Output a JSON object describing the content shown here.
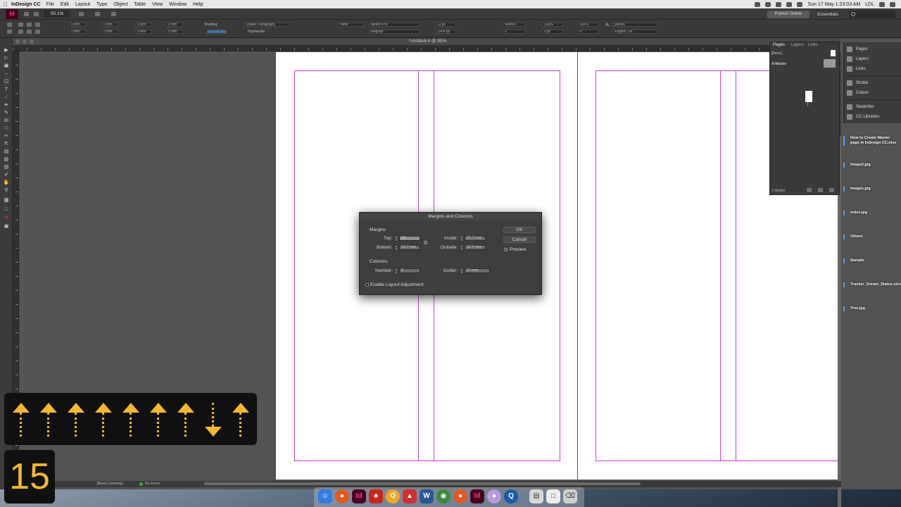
{
  "menubar": {
    "app_name": "InDesign CC",
    "items": [
      "File",
      "Edit",
      "Layout",
      "Type",
      "Object",
      "Table",
      "View",
      "Window",
      "Help"
    ],
    "clock": "Sun 17 May  1:23:03 AM",
    "user": "LDL"
  },
  "control": {
    "app_logo": "Id",
    "zoom": "95.1%",
    "publish_label": "Publish Online",
    "workspace": "Essentials",
    "shading_label": "Shading",
    "hyphenate_label": "Hyphenate",
    "paragraph_style": "[Basic Paragraph]",
    "font": "Minion Pro",
    "font_style": "Regular",
    "font_size": "12 pt",
    "leading": "(14.4 pt)",
    "kerning": "Metrics",
    "tracking": "0",
    "h_scale": "100%",
    "v_scale": "100%",
    "baseline": "0 pt",
    "skew": "0°",
    "char_style": "[None]",
    "language": "English: UK",
    "stroke_none": "None",
    "field_zero": "0 mm",
    "text_none": "[None]"
  },
  "document": {
    "title": "*Untitled-4 @ 95%"
  },
  "dialog": {
    "title": "Margins and Columns",
    "margins_label": "Margins",
    "top_label": "Top:",
    "top_value": "10",
    "bottom_label": "Bottom:",
    "bottom_value": "12.7 mm",
    "inside_label": "Inside:",
    "inside_value": "12.7 mm",
    "outside_label": "Outside:",
    "outside_value": "12.7 mm",
    "columns_label": "Columns",
    "number_label": "Number:",
    "number_value": "2",
    "gutter_label": "Gutter:",
    "gutter_value": "11 mm",
    "enable_layout_label": "Enable Layout Adjustment",
    "ok_label": "OK",
    "cancel_label": "Cancel",
    "preview_label": "Preview"
  },
  "pages_panel": {
    "tabs": [
      "Pages",
      "Layers",
      "Links"
    ],
    "none_label": "[None]",
    "master_label": "A-Master",
    "page_number": "1",
    "footer": "1 Master"
  },
  "right_dock": {
    "items": [
      "Pages",
      "Layers",
      "Links",
      "Stroke",
      "Colour",
      "Swatches",
      "CC Libraries"
    ],
    "icons": [
      "pages-icon",
      "layers-icon",
      "links-icon",
      "stroke-icon",
      "colour-icon",
      "swatches-icon",
      "cc-libraries-icon"
    ]
  },
  "desktop_files": [
    "How to Create Master page in Indesign CC.mov",
    "image2.jpg",
    "images.jpg",
    "index.jpg",
    "Others",
    "Sample",
    "Tracker_Sriram_Status.xlsx",
    "Tree.jpg"
  ],
  "statusbar": {
    "page_field": "1",
    "style": "[Basic] (working)",
    "errors": "No errors"
  },
  "overlay": {
    "counter": "15",
    "arrows": [
      "up",
      "up",
      "up",
      "up",
      "up",
      "up",
      "up",
      "down",
      "up"
    ],
    "color": "#f7b82d"
  },
  "colors": {
    "guide": "#c83fd6",
    "indesign_brand": "#ff3a84"
  }
}
